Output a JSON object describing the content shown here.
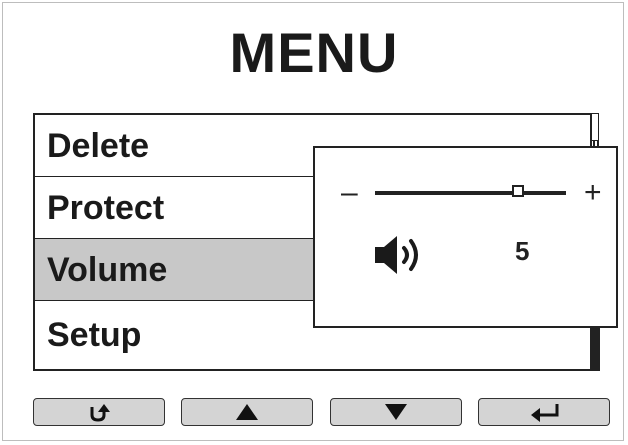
{
  "screen": {
    "title": "MENU"
  },
  "menu": {
    "items": [
      {
        "label": "Delete",
        "selected": false
      },
      {
        "label": "Protect",
        "selected": false
      },
      {
        "label": "Volume",
        "selected": true
      },
      {
        "label": "Setup",
        "selected": false
      }
    ]
  },
  "volume_popup": {
    "minus_label": "–",
    "plus_label": "+",
    "value": "5",
    "level_fraction": 0.75,
    "icon": "speaker-icon"
  },
  "buttons": [
    {
      "name": "back-button",
      "icon": "return-arrow-icon"
    },
    {
      "name": "up-button",
      "icon": "triangle-up-icon"
    },
    {
      "name": "down-button",
      "icon": "triangle-down-icon"
    },
    {
      "name": "enter-button",
      "icon": "enter-arrow-icon"
    }
  ]
}
